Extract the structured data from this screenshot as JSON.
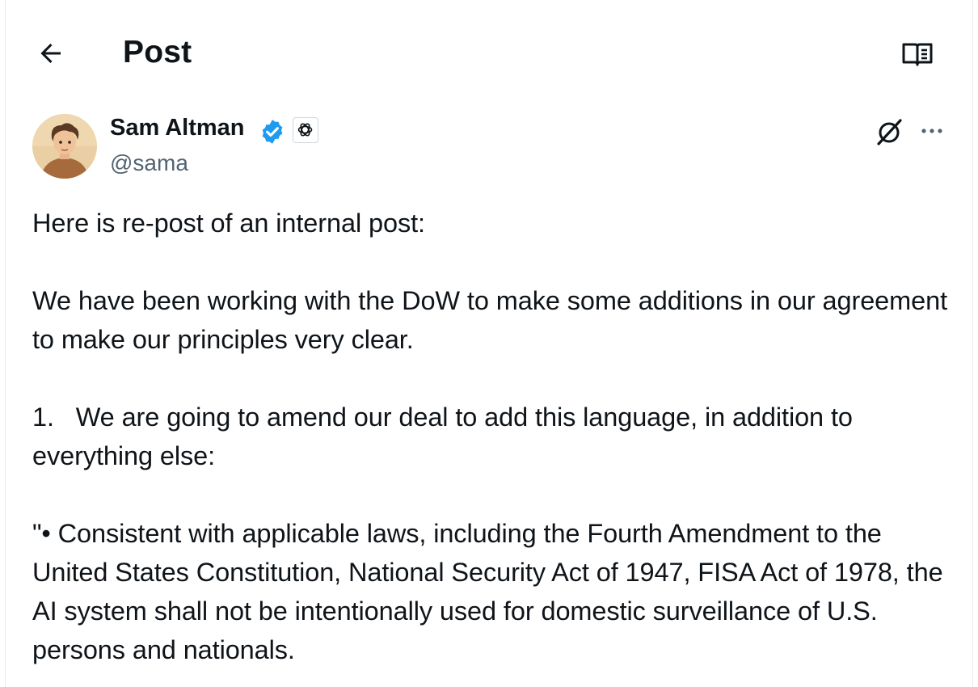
{
  "header": {
    "title": "Post",
    "back_icon": "arrow-left-icon",
    "reader_icon": "book-open-icon"
  },
  "author": {
    "name": "Sam Altman",
    "handle": "@sama",
    "verified_color": "#1d9bf0",
    "affiliation_icon": "openai-logo-icon"
  },
  "actions": {
    "grok_icon": "grok-icon",
    "more_icon": "more-horizontal-icon"
  },
  "post": {
    "line1": "Here is re-post of an internal post:",
    "para2": "We have been working with the DoW to make some additions in our agreement to make our principles very clear.",
    "para3": "1.   We are going to amend our deal to add this language, in addition to everything else:",
    "para4": "\"• Consistent with applicable laws, including the Fourth Amendment to the United States Constitution, National Security Act of 1947, FISA Act of 1978, the AI system shall not be intentionally used for domestic surveillance of U.S. persons and nationals."
  }
}
